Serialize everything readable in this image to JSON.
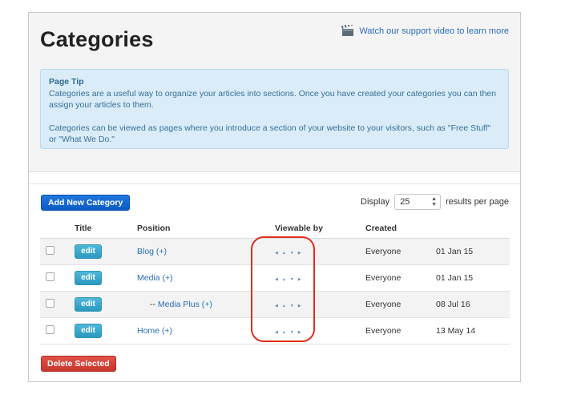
{
  "header": {
    "title": "Categories",
    "support_link": "Watch our support video to learn more",
    "support_icon": "clapperboard-icon"
  },
  "page_tip": {
    "heading": "Page Tip",
    "paragraph1": "Categories are a useful way to organize your articles into sections. Once you have created your categories you can then assign your articles to them.",
    "paragraph2": "Categories can be viewed as pages where you introduce a section of your website to your visitors, such as \"Free Stuff\" or \"What We Do.\""
  },
  "toolbar": {
    "add_label": "Add New Category",
    "display_label": "Display",
    "results_value": "25",
    "results_suffix": "results per page"
  },
  "table": {
    "columns": [
      "Title",
      "Position",
      "Viewable by",
      "Created"
    ],
    "rows": [
      {
        "edit": "edit",
        "title": "Blog (+)",
        "prefix": "",
        "viewable": "Everyone",
        "created": "01 Jan 15"
      },
      {
        "edit": "edit",
        "title": "Media (+)",
        "prefix": "",
        "viewable": "Everyone",
        "created": "01 Jan 15"
      },
      {
        "edit": "edit",
        "title": "Media Plus (+)",
        "prefix": "-- ",
        "viewable": "Everyone",
        "created": "08 Jul 16"
      },
      {
        "edit": "edit",
        "title": "Home (+)",
        "prefix": "",
        "viewable": "Everyone",
        "created": "13 May 14"
      }
    ],
    "position_controls": [
      "◀",
      "▲",
      "▼",
      "▶"
    ]
  },
  "footer": {
    "delete_label": "Delete Selected"
  },
  "colors": {
    "primary_button": "#0d5ac4",
    "edit_button": "#2a98c0",
    "delete_button": "#c6362d",
    "link": "#2a6db5",
    "highlight": "#e0301e",
    "tip_background": "#d9ecf8"
  }
}
